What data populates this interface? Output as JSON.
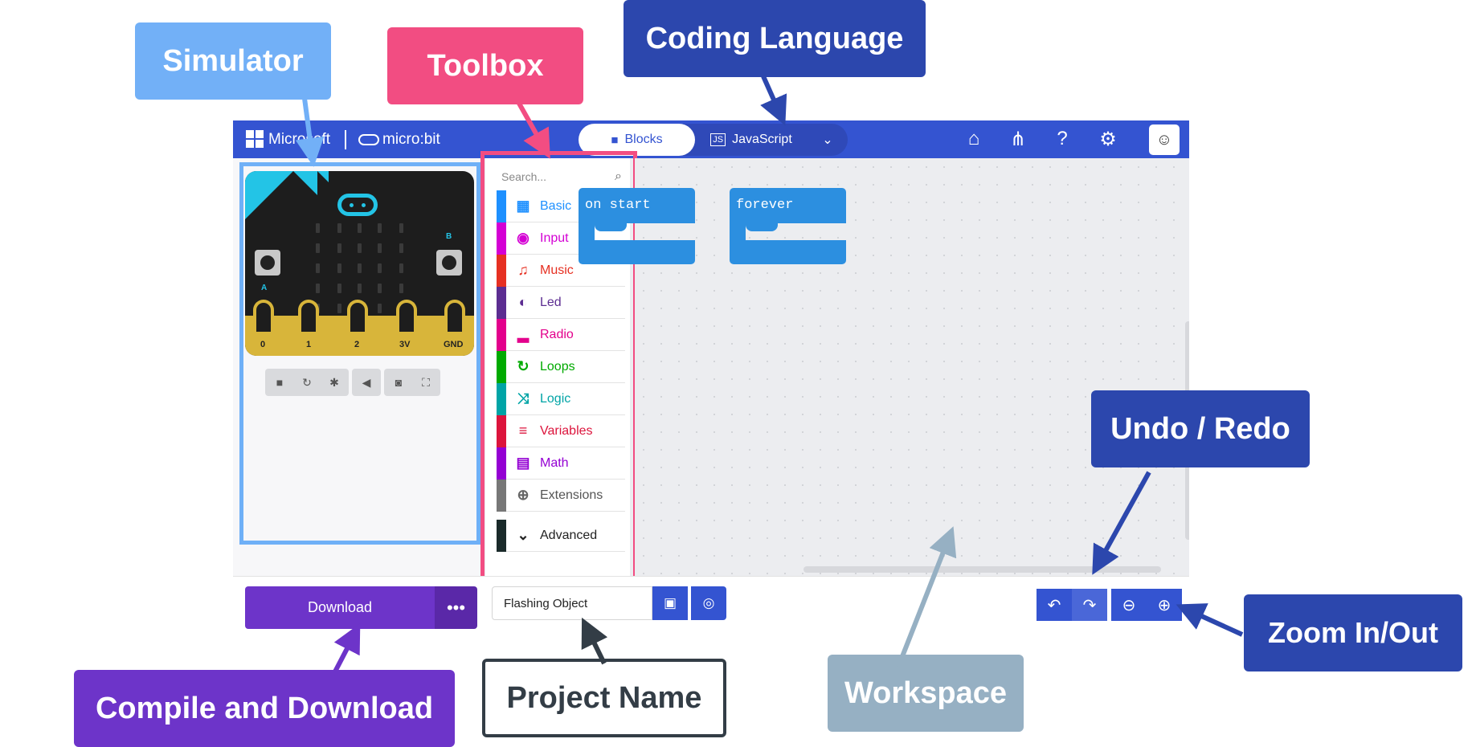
{
  "topbar": {
    "microsoft_label": "Microsoft",
    "microbit_label": "micro:bit",
    "blocks_label": "Blocks",
    "javascript_label": "JavaScript"
  },
  "toolbox": {
    "search_placeholder": "Search...",
    "categories": [
      {
        "label": "Basic",
        "color": "#1e90ff",
        "icon": "grid-icon"
      },
      {
        "label": "Input",
        "color": "#d400d4",
        "icon": "target-icon"
      },
      {
        "label": "Music",
        "color": "#e63022",
        "icon": "headphones-icon"
      },
      {
        "label": "Led",
        "color": "#5c2d91",
        "icon": "toggle-icon"
      },
      {
        "label": "Radio",
        "color": "#e3008c",
        "icon": "signal-bars-icon"
      },
      {
        "label": "Loops",
        "color": "#00aa00",
        "icon": "refresh-icon"
      },
      {
        "label": "Logic",
        "color": "#00a4a6",
        "icon": "shuffle-icon"
      },
      {
        "label": "Variables",
        "color": "#dc143c",
        "icon": "list-icon"
      },
      {
        "label": "Math",
        "color": "#9400d3",
        "icon": "calculator-icon"
      },
      {
        "label": "Extensions",
        "color": "#777777",
        "icon": "plus-circle-icon"
      },
      {
        "label": "Advanced",
        "color": "#1a2a2a",
        "icon": "chevron-down-icon"
      }
    ]
  },
  "simulator": {
    "button_a": "A",
    "button_b": "B",
    "pins": [
      "0",
      "1",
      "2",
      "3V",
      "GND"
    ]
  },
  "workspace": {
    "blocks": [
      {
        "label": "on start"
      },
      {
        "label": "forever"
      }
    ]
  },
  "bottombar": {
    "download_label": "Download",
    "download_more_label": "•••",
    "project_name_value": "Flashing Object"
  },
  "callouts": {
    "simulator": "Simulator",
    "toolbox": "Toolbox",
    "coding_language": "Coding Language",
    "undo_redo": "Undo / Redo",
    "zoom": "Zoom In/Out",
    "workspace": "Workspace",
    "project_name": "Project Name",
    "compile_download": "Compile and Download"
  },
  "colors": {
    "header_blue": "#3454d1",
    "download_purple": "#6d34c9",
    "toolbox_highlight": "#f24d82",
    "simulator_highlight": "#72b0f7",
    "block_blue": "#2c8fe0"
  }
}
